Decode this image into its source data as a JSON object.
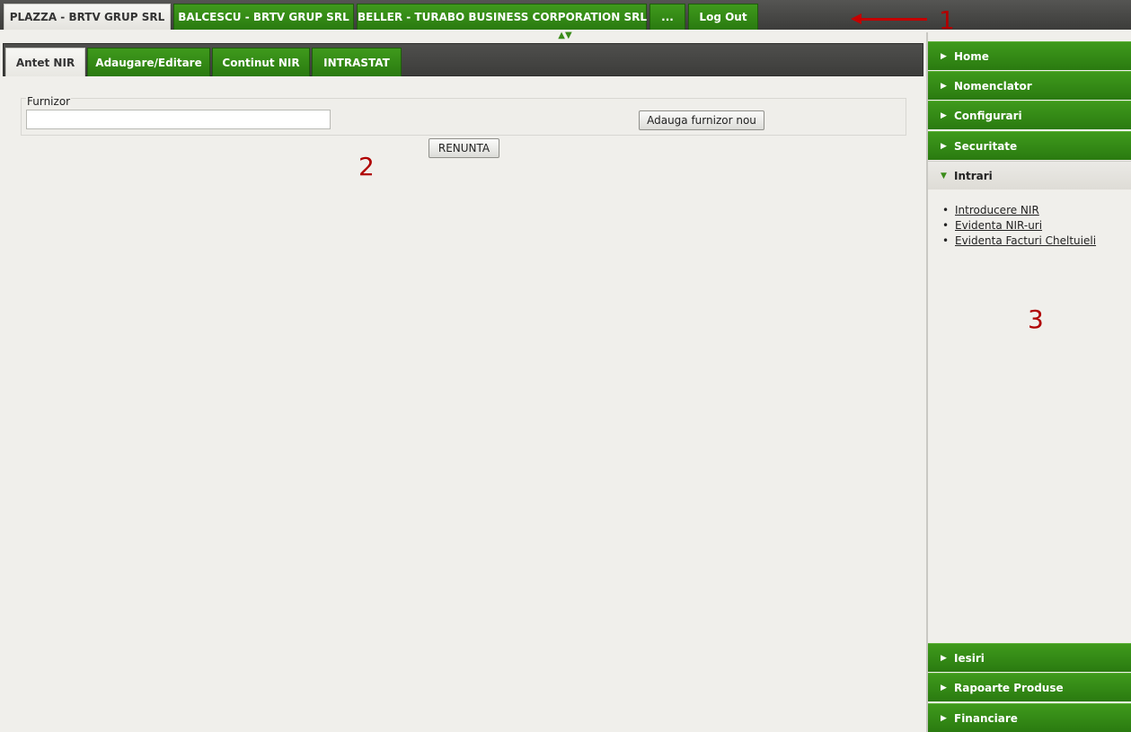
{
  "top_tabs": [
    {
      "label": "PLAZZA - BRTV GRUP SRL",
      "active": true
    },
    {
      "label": "BALCESCU - BRTV GRUP SRL",
      "active": false
    },
    {
      "label": "BELLER - TURABO BUSINESS CORPORATION SRL",
      "active": false
    },
    {
      "label": "...",
      "active": false
    },
    {
      "label": "Log Out",
      "active": false
    }
  ],
  "annotations": {
    "one": "1",
    "two": "2",
    "three": "3"
  },
  "content_tabs": [
    {
      "label": "Antet NIR",
      "active": true
    },
    {
      "label": "Adaugare/Editare",
      "active": false
    },
    {
      "label": "Continut NIR",
      "active": false
    },
    {
      "label": "INTRASTAT",
      "active": false
    }
  ],
  "form": {
    "furnizor_label": "Furnizor",
    "furnizor_value": "",
    "add_supplier_button": "Adauga furnizor nou",
    "cancel_button": "RENUNTA"
  },
  "sidebar": {
    "items_top": [
      "Home",
      "Nomenclator",
      "Configurari",
      "Securitate"
    ],
    "open_section": "Intrari",
    "sub_items": [
      "Introducere NIR",
      "Evidenta NIR-uri",
      "Evidenta Facturi Cheltuieli"
    ],
    "items_bottom": [
      "Iesiri",
      "Rapoarte Produse",
      "Financiare"
    ]
  },
  "colors": {
    "accent_green": "#2f8214",
    "annotation_red": "#c40000"
  },
  "icons": {
    "collapsed": "triangle-right-icon",
    "expanded": "triangle-down-icon",
    "splitter": "splitter-arrows-icon"
  }
}
